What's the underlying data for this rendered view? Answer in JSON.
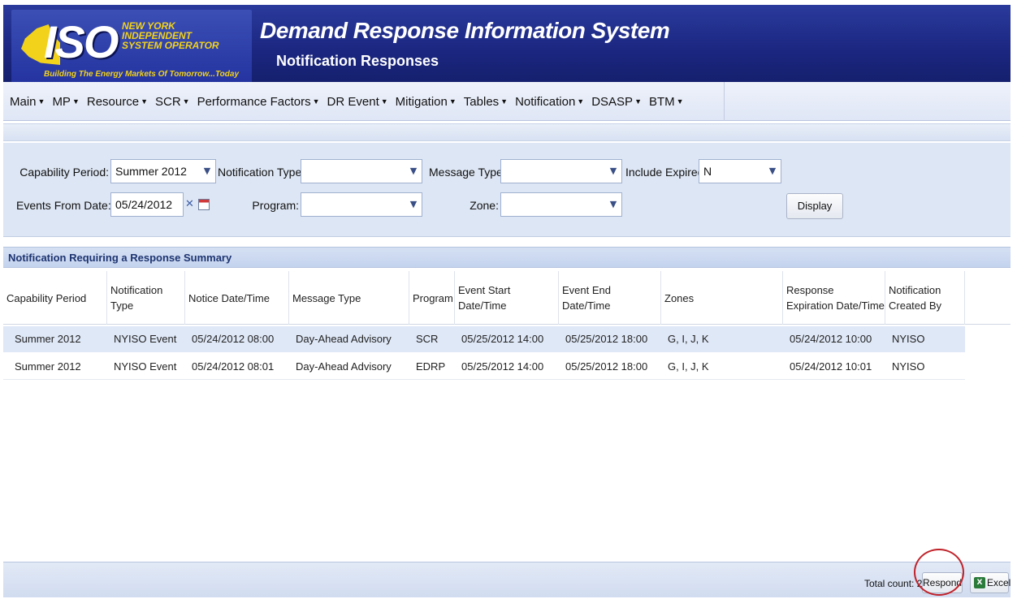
{
  "header": {
    "logo_big": "ISO",
    "logo_lines": [
      "NEW YORK",
      "INDEPENDENT",
      "SYSTEM OPERATOR"
    ],
    "tagline": "Building The Energy Markets Of Tomorrow...Today",
    "app_title": "Demand Response Information System",
    "page_subtitle": "Notification Responses"
  },
  "menu": {
    "items": [
      "Main",
      "MP",
      "Resource",
      "SCR",
      "Performance Factors",
      "DR Event",
      "Mitigation",
      "Tables",
      "Notification",
      "DSASP",
      "BTM"
    ]
  },
  "filters": {
    "capability_period_label": "Capability Period:",
    "capability_period_value": "Summer 2012",
    "notification_type_label": "Notification Type:",
    "notification_type_value": "",
    "message_type_label": "Message Type:",
    "message_type_value": "",
    "include_expired_label": "Include Expired:",
    "include_expired_value": "N",
    "events_from_date_label": "Events From Date:",
    "events_from_date_value": "05/24/2012",
    "program_label": "Program:",
    "program_value": "",
    "zone_label": "Zone:",
    "zone_value": "",
    "display_button": "Display"
  },
  "grid": {
    "title": "Notification Requiring a Response Summary",
    "columns": [
      [
        "Capability Period"
      ],
      [
        "Notification",
        "Type"
      ],
      [
        "Notice Date/Time"
      ],
      [
        "Message Type"
      ],
      [
        "Program"
      ],
      [
        "Event Start",
        "Date/Time"
      ],
      [
        "Event End",
        "Date/Time"
      ],
      [
        "Zones"
      ],
      [
        "Response",
        "Expiration Date/Time"
      ],
      [
        "Notification",
        "Created By"
      ]
    ],
    "rows": [
      [
        "Summer 2012",
        "NYISO Event",
        "05/24/2012 08:00",
        "Day-Ahead Advisory",
        "SCR",
        "05/25/2012 14:00",
        "05/25/2012 18:00",
        "G, I, J, K",
        "05/24/2012 10:00",
        "NYISO"
      ],
      [
        "Summer 2012",
        "NYISO Event",
        "05/24/2012 08:01",
        "Day-Ahead Advisory",
        "EDRP",
        "05/25/2012 14:00",
        "05/25/2012 18:00",
        "G, I, J, K",
        "05/24/2012 10:01",
        "NYISO"
      ]
    ]
  },
  "footer": {
    "total_count": "Total count: 2",
    "respond_button": "Respond",
    "excel_button": "Excel"
  },
  "colors": {
    "header_blue": "#1b2680",
    "logo_yellow": "#f2d21b",
    "panel_blue": "#dde6f4",
    "selected_row": "#dfe8f7",
    "highlight_circle": "#c0222a"
  }
}
